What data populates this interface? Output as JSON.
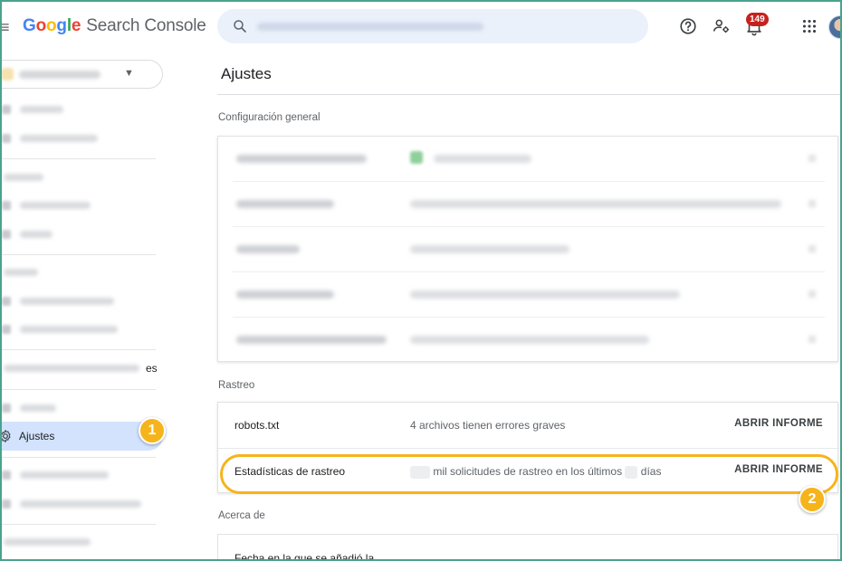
{
  "app": {
    "name_google": "Google",
    "name_product": "Search Console",
    "logo_colors": [
      "#4285f4",
      "#ea4335",
      "#fbbc05",
      "#4285f4",
      "#34a853",
      "#ea4335"
    ]
  },
  "header": {
    "menu_icon": "menu-icon",
    "search_icon": "search-icon",
    "icons": [
      "help-icon",
      "admin-icon",
      "bell-icon",
      "apps-icon"
    ],
    "notification_count": "149"
  },
  "sidebar": {
    "partial_text": "es",
    "active_item": {
      "icon": "gear-icon",
      "label": "Ajustes"
    }
  },
  "main": {
    "page_title": "Ajustes",
    "section_general": "Configuración general",
    "section_crawl": "Rastreo",
    "section_about": "Acerca de",
    "crawl_rows": [
      {
        "name": "robots.txt",
        "description": "4 archivos tienen errores graves",
        "action": "ABRIR INFORME"
      },
      {
        "name": "Estadísticas de rastreo",
        "desc_part1": "mil solicitudes de rastreo en los últimos",
        "desc_part2": "días",
        "action": "ABRIR INFORME"
      }
    ],
    "about_text": "Fecha en la que se añadió la"
  },
  "annotations": {
    "marker_1": "1",
    "marker_2": "2",
    "accent_color": "#f6b41c"
  }
}
